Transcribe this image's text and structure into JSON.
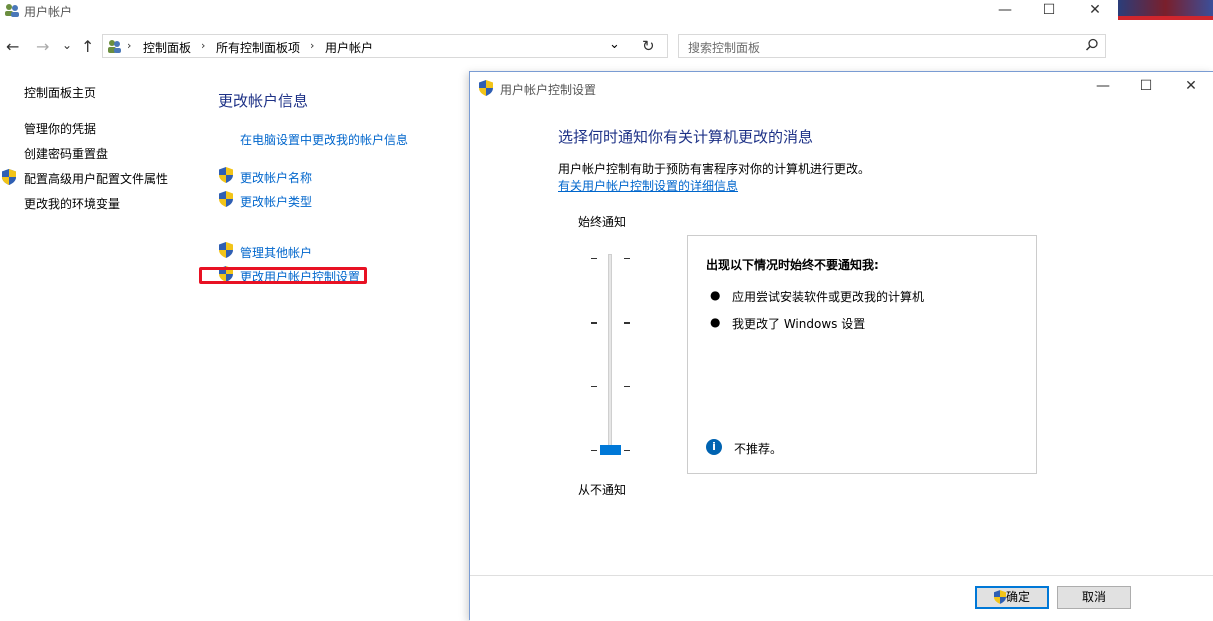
{
  "window": {
    "title": "用户帐户",
    "controls": {
      "minimize": "—",
      "maximize": "☐",
      "close": "✕"
    }
  },
  "nav": {
    "back": "←",
    "forward": "→",
    "dropdown": "⌄",
    "up": "↑",
    "breadcrumbs": [
      "控制面板",
      "所有控制面板项",
      "用户帐户"
    ],
    "refresh": "↻",
    "address_dropdown": "⌄"
  },
  "search": {
    "placeholder": "搜索控制面板",
    "icon": "search-icon"
  },
  "sidebar": {
    "items": [
      {
        "label": "控制面板主页"
      },
      {
        "label": "管理你的凭据"
      },
      {
        "label": "创建密码重置盘"
      },
      {
        "label": "配置高级用户配置文件属性"
      },
      {
        "label": "更改我的环境变量"
      }
    ]
  },
  "main": {
    "heading": "更改帐户信息",
    "links": [
      {
        "label": "在电脑设置中更改我的帐户信息"
      },
      {
        "label": "更改帐户名称"
      },
      {
        "label": "更改帐户类型"
      },
      {
        "label": "管理其他帐户"
      },
      {
        "label": "更改用户帐户控制设置"
      }
    ]
  },
  "uac": {
    "title": "用户帐户控制设置",
    "heading": "选择何时通知你有关计算机更改的消息",
    "description": "用户帐户控制有助于预防有害程序对你的计算机进行更改。",
    "link": "有关用户帐户控制设置的详细信息",
    "slider": {
      "top_label": "始终通知",
      "bottom_label": "从不通知",
      "level": 0,
      "levels": 4
    },
    "info": {
      "title": "出现以下情况时始终不要通知我:",
      "bullets": [
        "应用尝试安装软件或更改我的计算机",
        "我更改了 Windows 设置"
      ],
      "note": "不推荐。"
    },
    "buttons": {
      "ok": "确定",
      "cancel": "取消"
    }
  },
  "colors": {
    "accent": "#0078d7",
    "link": "#0066cc",
    "highlight": "#e81123",
    "heading": "#1e3287"
  }
}
